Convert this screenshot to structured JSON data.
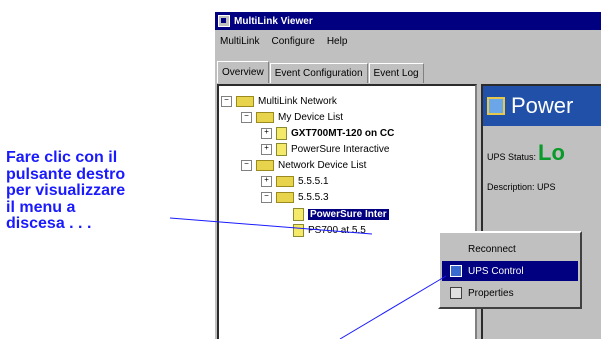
{
  "callout": {
    "lines": [
      "Fare clic con il",
      "pulsante destro",
      "per visualizzare",
      "il menu a",
      "discesa . . ."
    ],
    "color": "#1a1aff"
  },
  "window": {
    "title": "MultiLink Viewer",
    "menus": [
      "MultiLink",
      "Configure",
      "Help"
    ],
    "tabs": [
      "Overview",
      "Event Configuration",
      "Event Log"
    ]
  },
  "tree": {
    "nodes": [
      {
        "label": "MultiLink Network",
        "expander": "−"
      },
      {
        "label": "My Device List",
        "expander": "−"
      },
      {
        "label": "GXT700MT-120 on CC",
        "expander": "+"
      },
      {
        "label": "PowerSure Interactive",
        "expander": "+"
      },
      {
        "label": "Network Device List",
        "expander": "−"
      },
      {
        "label": "5.5.5.1",
        "expander": "+"
      },
      {
        "label": "5.5.5.3",
        "expander": "−"
      },
      {
        "label": "PowerSure Inter",
        "expander": ""
      },
      {
        "label": "PS700 at 5.5",
        "expander": ""
      }
    ]
  },
  "detail": {
    "header": "Power",
    "status_label": "UPS Status:",
    "status_value": "Lo",
    "description_label": "Description: UPS"
  },
  "context_menu": {
    "items": [
      "Reconnect",
      "UPS Control",
      "Properties"
    ],
    "highlight_color": "#000080"
  }
}
